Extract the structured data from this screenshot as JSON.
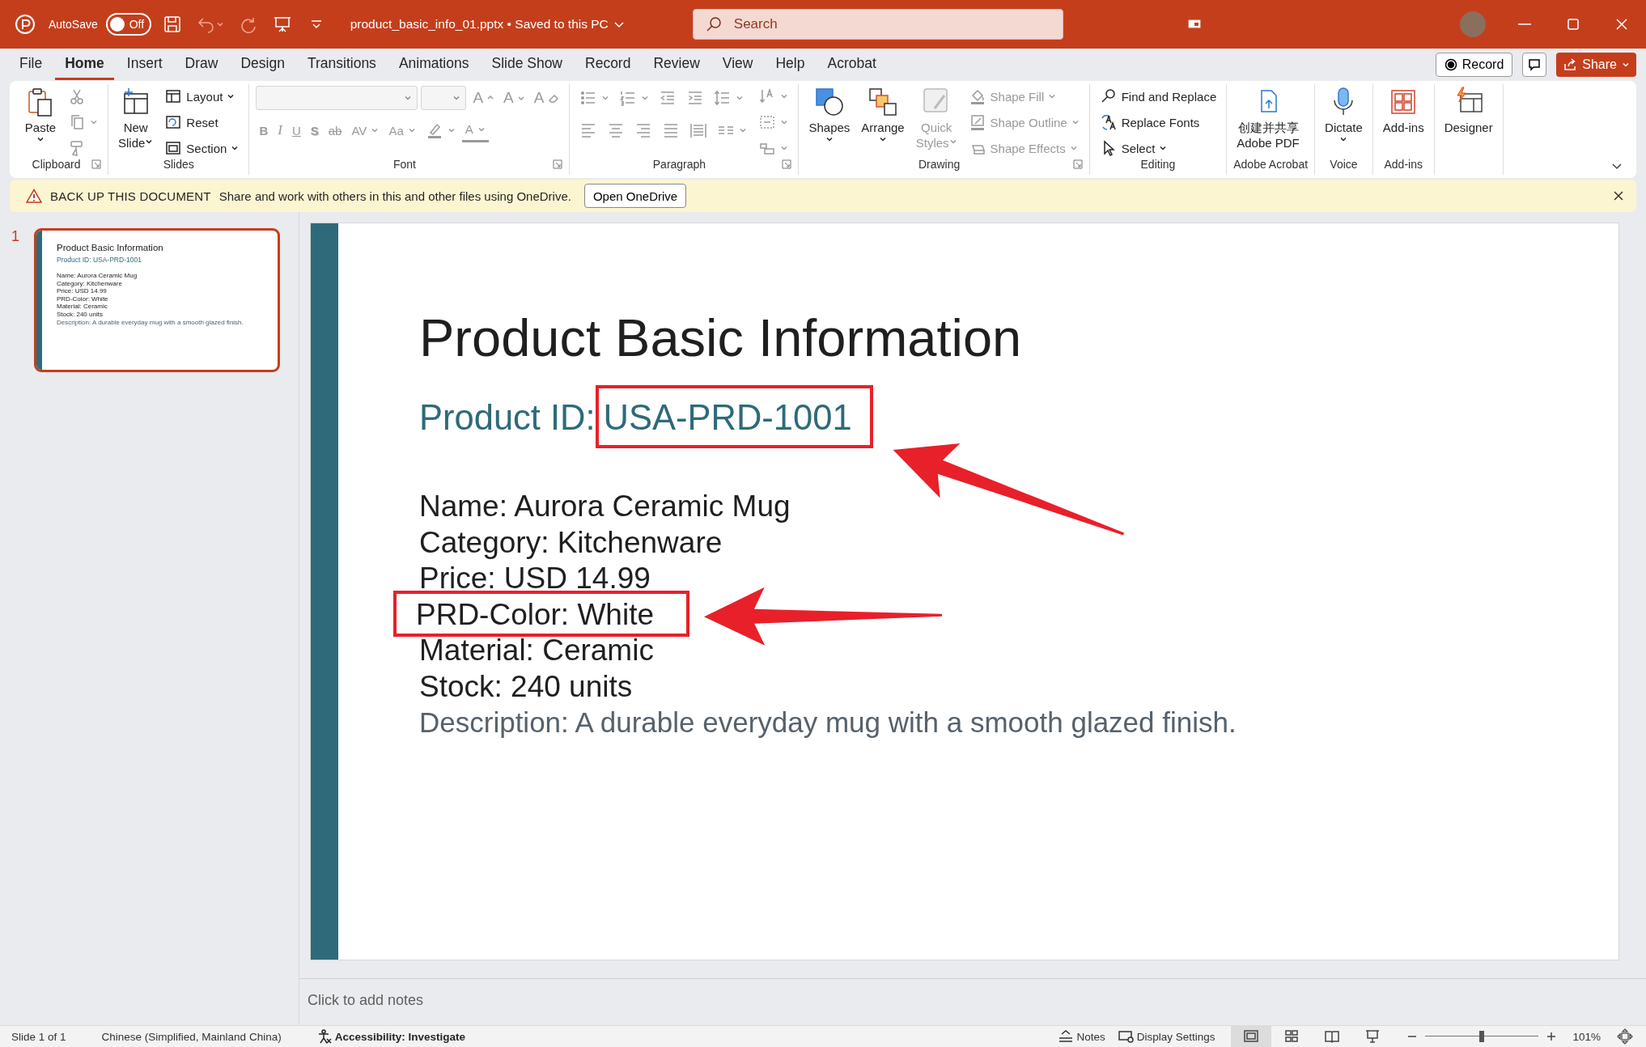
{
  "title_bar": {
    "autosave_label": "AutoSave",
    "autosave": {
      "label": "Off",
      "on": false
    },
    "quick_access": [
      {
        "kind": "save",
        "disabled": false
      },
      {
        "kind": "undo",
        "disabled": true
      },
      {
        "kind": "redo",
        "disabled": true
      },
      {
        "kind": "present",
        "disabled": false
      },
      {
        "kind": "customize",
        "disabled": false
      }
    ],
    "document_title": "product_basic_info_01.pptx • Saved to this PC",
    "search": {
      "placeholder": "Search"
    }
  },
  "ribbon_tabs": [
    {
      "label": "File",
      "selected": false
    },
    {
      "label": "Home",
      "selected": true
    },
    {
      "label": "Insert",
      "selected": false
    },
    {
      "label": "Draw",
      "selected": false
    },
    {
      "label": "Design",
      "selected": false
    },
    {
      "label": "Transitions",
      "selected": false
    },
    {
      "label": "Animations",
      "selected": false
    },
    {
      "label": "Slide Show",
      "selected": false
    },
    {
      "label": "Record",
      "selected": false
    },
    {
      "label": "Review",
      "selected": false
    },
    {
      "label": "View",
      "selected": false
    },
    {
      "label": "Help",
      "selected": false
    },
    {
      "label": "Acrobat",
      "selected": false
    }
  ],
  "ribbon_actions": {
    "record": "Record",
    "share": "Share"
  },
  "ribbon": {
    "groups": [
      {
        "label": "Clipboard",
        "launcher": true,
        "sections": [
          {
            "kind": "large",
            "lines": [
              "Paste"
            ],
            "dropdown": true,
            "disabled": false
          },
          {
            "kind": "stack",
            "items": [
              {
                "kind": "button",
                "dropdown": false,
                "disabled": true
              },
              {
                "kind": "button",
                "dropdown": true,
                "disabled": true
              },
              {
                "kind": "button",
                "dropdown": false,
                "disabled": true
              }
            ]
          }
        ]
      },
      {
        "label": "Slides",
        "launcher": false,
        "sections": [
          {
            "kind": "large",
            "lines": [
              "New",
              "Slide"
            ],
            "dropdown": true,
            "disabled": false
          },
          {
            "kind": "stack",
            "items": [
              {
                "kind": "button",
                "label": "Layout",
                "dropdown": true,
                "disabled": false
              },
              {
                "kind": "button",
                "label": "Reset",
                "dropdown": false,
                "disabled": false
              },
              {
                "kind": "button",
                "label": "Section",
                "dropdown": true,
                "disabled": false
              }
            ]
          }
        ]
      },
      {
        "label": "Font",
        "launcher": true,
        "sections": [
          {
            "kind": "rows",
            "rows": [
              [
                {
                  "kind": "combo",
                  "disabled": true
                },
                {
                  "kind": "combo",
                  "disabled": true
                },
                {
                  "kind": "button",
                  "label": "A",
                  "dropdown": false,
                  "disabled": true
                },
                {
                  "kind": "button",
                  "label": "A",
                  "dropdown": false,
                  "disabled": true
                },
                {
                  "kind": "button",
                  "label": "A",
                  "dropdown": false,
                  "disabled": true
                }
              ],
              [
                {
                  "kind": "button",
                  "label": "B",
                  "dropdown": false,
                  "disabled": true
                },
                {
                  "kind": "button",
                  "label": "I",
                  "dropdown": false,
                  "disabled": true
                },
                {
                  "kind": "button",
                  "label": "U",
                  "dropdown": false,
                  "disabled": true
                },
                {
                  "kind": "button",
                  "label": "S",
                  "dropdown": false,
                  "disabled": true
                },
                {
                  "kind": "button",
                  "label": "ab",
                  "dropdown": false,
                  "disabled": true
                },
                {
                  "kind": "button",
                  "label": "AV",
                  "dropdown": true,
                  "disabled": true
                },
                {
                  "kind": "button",
                  "label": "Aa",
                  "dropdown": true,
                  "disabled": true
                },
                {
                  "kind": "button",
                  "dropdown": true,
                  "disabled": true
                },
                {
                  "kind": "button",
                  "label": "A",
                  "dropdown": true,
                  "disabled": true
                }
              ]
            ]
          }
        ]
      },
      {
        "label": "Paragraph",
        "launcher": true,
        "sections": [
          {
            "kind": "rows",
            "rows": [
              [
                {
                  "kind": "button",
                  "dropdown": true,
                  "disabled": true
                },
                {
                  "kind": "button",
                  "dropdown": true,
                  "disabled": true
                },
                {
                  "kind": "button",
                  "dropdown": false,
                  "disabled": true
                },
                {
                  "kind": "button",
                  "dropdown": false,
                  "disabled": true
                },
                {
                  "kind": "button",
                  "dropdown": true,
                  "disabled": true
                }
              ],
              [
                {
                  "kind": "button",
                  "dropdown": false,
                  "disabled": true
                },
                {
                  "kind": "button",
                  "dropdown": false,
                  "disabled": true
                },
                {
                  "kind": "button",
                  "dropdown": false,
                  "disabled": true
                },
                {
                  "kind": "button",
                  "dropdown": false,
                  "disabled": true
                },
                {
                  "kind": "button",
                  "dropdown": false,
                  "disabled": true
                },
                {
                  "kind": "button",
                  "dropdown": true,
                  "disabled": true
                }
              ]
            ]
          },
          {
            "kind": "stack",
            "items": [
              {
                "kind": "button",
                "dropdown": true,
                "disabled": true
              },
              {
                "kind": "button",
                "dropdown": true,
                "disabled": true
              },
              {
                "kind": "button",
                "dropdown": true,
                "disabled": true
              }
            ]
          }
        ]
      },
      {
        "label": "Drawing",
        "launcher": true,
        "sections": [
          {
            "kind": "large",
            "lines": [
              "Shapes"
            ],
            "dropdown": true,
            "disabled": false
          },
          {
            "kind": "large",
            "lines": [
              "Arrange"
            ],
            "dropdown": true,
            "disabled": false
          },
          {
            "kind": "large",
            "lines": [
              "Quick",
              "Styles"
            ],
            "dropdown": true,
            "disabled": true
          },
          {
            "kind": "stack",
            "items": [
              {
                "kind": "button",
                "label": "Shape Fill",
                "dropdown": true,
                "disabled": true
              },
              {
                "kind": "button",
                "label": "Shape Outline",
                "dropdown": true,
                "disabled": true
              },
              {
                "kind": "button",
                "label": "Shape Effects",
                "dropdown": true,
                "disabled": true
              }
            ]
          }
        ]
      },
      {
        "label": "Editing",
        "launcher": false,
        "sections": [
          {
            "kind": "stack",
            "items": [
              {
                "kind": "button",
                "label": "Find and Replace",
                "dropdown": false,
                "disabled": false
              },
              {
                "kind": "button",
                "label": "Replace Fonts",
                "dropdown": false,
                "disabled": false
              },
              {
                "kind": "button",
                "label": "Select",
                "dropdown": true,
                "disabled": false
              }
            ]
          }
        ]
      },
      {
        "label": "Adobe Acrobat",
        "launcher": false,
        "sections": [
          {
            "kind": "large",
            "lines": [
              "创建并共享",
              "Adobe PDF"
            ],
            "dropdown": false,
            "disabled": false
          }
        ]
      },
      {
        "label": "Voice",
        "launcher": false,
        "sections": [
          {
            "kind": "large",
            "lines": [
              "Dictate"
            ],
            "dropdown": true,
            "disabled": false
          }
        ]
      },
      {
        "label": "Add-ins",
        "launcher": false,
        "sections": [
          {
            "kind": "large",
            "lines": [
              "Add-ins"
            ],
            "dropdown": false,
            "disabled": false
          }
        ]
      },
      {
        "launcher": false,
        "sections": [
          {
            "kind": "large",
            "lines": [
              "Designer"
            ],
            "dropdown": false,
            "disabled": false
          }
        ]
      }
    ]
  },
  "message_bar": {
    "title": "BACK UP THIS DOCUMENT",
    "message": "Share and work with others in this and other files using OneDrive.",
    "button": "Open OneDrive"
  },
  "thumbnails": [
    {
      "number": "1",
      "selected": true,
      "title": "Product Basic Information",
      "subtitle": "Product ID: USA-PRD-1001",
      "lines": [
        {
          "kind": "field",
          "text": "Name: Aurora Ceramic Mug"
        },
        {
          "kind": "field",
          "text": "Category: Kitchenware"
        },
        {
          "kind": "field",
          "text": "Price: USD 14.99"
        },
        {
          "kind": "field",
          "text": "PRD-Color: White"
        },
        {
          "kind": "field",
          "text": "Material: Ceramic"
        },
        {
          "kind": "field",
          "text": "Stock: 240 units"
        },
        {
          "kind": "description",
          "text": "Description: A durable everyday mug with a smooth glazed finish."
        }
      ]
    }
  ],
  "slide": {
    "title": "Product Basic Information",
    "product_id": {
      "label": "Product ID:",
      "value": "USA-PRD-1001",
      "highlighted": true
    },
    "details": [
      {
        "kind": "field",
        "text": "Name: Aurora Ceramic Mug",
        "highlighted": false
      },
      {
        "kind": "field",
        "text": "Category: Kitchenware",
        "highlighted": false
      },
      {
        "kind": "field",
        "text": "Price: USD 14.99",
        "highlighted": false
      },
      {
        "kind": "field",
        "text": "PRD-Color: White",
        "highlighted": true
      },
      {
        "kind": "field",
        "text": "Material: Ceramic",
        "highlighted": false
      },
      {
        "kind": "field",
        "text": "Stock: 240 units",
        "highlighted": false
      },
      {
        "kind": "description",
        "text": "Description: A durable everyday mug with a smooth glazed finish.",
        "highlighted": false
      }
    ]
  },
  "notes": {
    "placeholder": "Click to add notes"
  },
  "status_bar": {
    "slide_info": "Slide 1 of 1",
    "language": "Chinese (Simplified, Mainland China)",
    "accessibility": "Accessibility: Investigate",
    "notes": "Notes",
    "display_settings": "Display Settings",
    "views": [
      {
        "selected": true
      },
      {
        "selected": false
      },
      {
        "selected": false
      },
      {
        "selected": false
      }
    ],
    "zoom": {
      "level": 0.5,
      "percent": "101%"
    }
  }
}
